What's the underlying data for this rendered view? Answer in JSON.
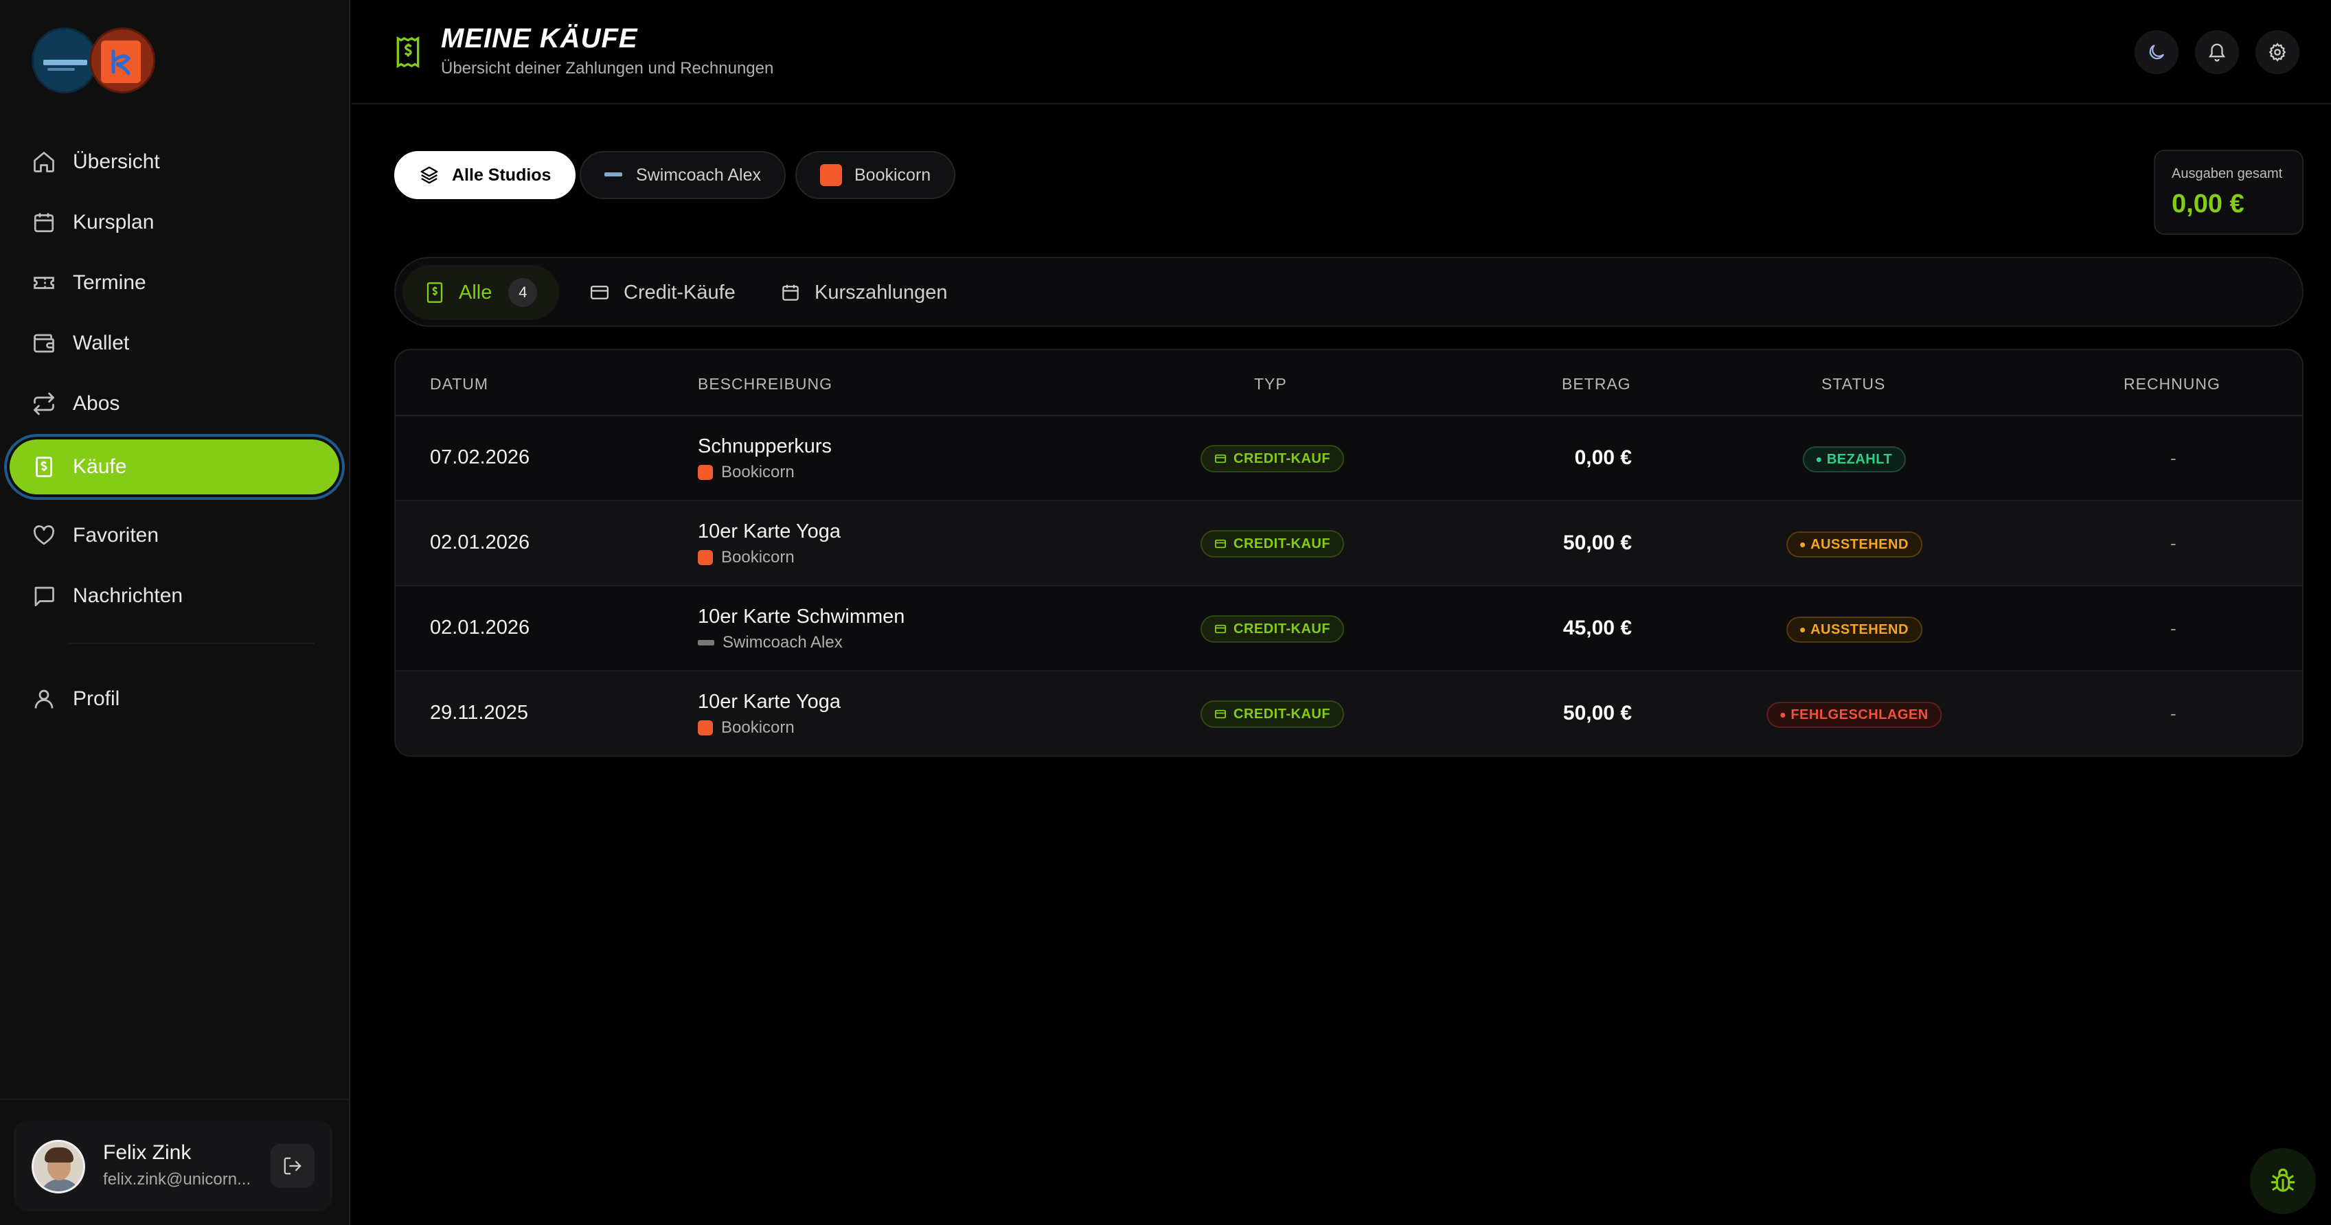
{
  "sidebar": {
    "nav": [
      {
        "label": "Übersicht",
        "icon": "home-icon"
      },
      {
        "label": "Kursplan",
        "icon": "calendar-icon"
      },
      {
        "label": "Termine",
        "icon": "ticket-icon"
      },
      {
        "label": "Wallet",
        "icon": "wallet-icon"
      },
      {
        "label": "Abos",
        "icon": "repeat-icon"
      },
      {
        "label": "Käufe",
        "icon": "receipt-icon",
        "active": true
      },
      {
        "label": "Favoriten",
        "icon": "heart-icon"
      },
      {
        "label": "Nachrichten",
        "icon": "message-icon"
      }
    ],
    "profile_label": "Profil",
    "user": {
      "name": "Felix Zink",
      "email": "felix.zink@unicorn..."
    }
  },
  "header": {
    "title": "MEINE KÄUFE",
    "subtitle": "Übersicht deiner Zahlungen und Rechnungen"
  },
  "studios": {
    "items": [
      {
        "label": "Alle Studios",
        "active": true
      },
      {
        "label": "Swimcoach Alex",
        "active": false
      },
      {
        "label": "Bookicorn",
        "active": false
      }
    ]
  },
  "total": {
    "label": "Ausgaben gesamt",
    "value": "0,00 €"
  },
  "filters": {
    "tabs": [
      {
        "label": "Alle",
        "count": "4",
        "active": true
      },
      {
        "label": "Credit-Käufe",
        "active": false
      },
      {
        "label": "Kurszahlungen",
        "active": false
      }
    ]
  },
  "table": {
    "headers": {
      "date": "DATUM",
      "description": "BESCHREIBUNG",
      "type": "TYP",
      "amount": "BETRAG",
      "status": "STATUS",
      "invoice": "RECHNUNG"
    },
    "rows": [
      {
        "date": "07.02.2026",
        "title": "Schnupperkurs",
        "studio": "Bookicorn",
        "studio_kind": "book",
        "type": "CREDIT-KAUF",
        "amount": "0,00 €",
        "status": "BEZAHLT",
        "status_kind": "paid",
        "invoice": "-"
      },
      {
        "date": "02.01.2026",
        "title": "10er Karte Yoga",
        "studio": "Bookicorn",
        "studio_kind": "book",
        "type": "CREDIT-KAUF",
        "amount": "50,00 €",
        "status": "AUSSTEHEND",
        "status_kind": "pending",
        "invoice": "-"
      },
      {
        "date": "02.01.2026",
        "title": "10er Karte Schwimmen",
        "studio": "Swimcoach Alex",
        "studio_kind": "swim",
        "type": "CREDIT-KAUF",
        "amount": "45,00 €",
        "status": "AUSSTEHEND",
        "status_kind": "pending",
        "invoice": "-"
      },
      {
        "date": "29.11.2025",
        "title": "10er Karte Yoga",
        "studio": "Bookicorn",
        "studio_kind": "book",
        "type": "CREDIT-KAUF",
        "amount": "50,00 €",
        "status": "FEHLGESCHLAGEN",
        "status_kind": "failed",
        "invoice": "-"
      }
    ]
  },
  "colors": {
    "accent": "#84cc16",
    "paid": "#2fcf8c",
    "pending": "#f5a623",
    "failed": "#f0533d"
  }
}
